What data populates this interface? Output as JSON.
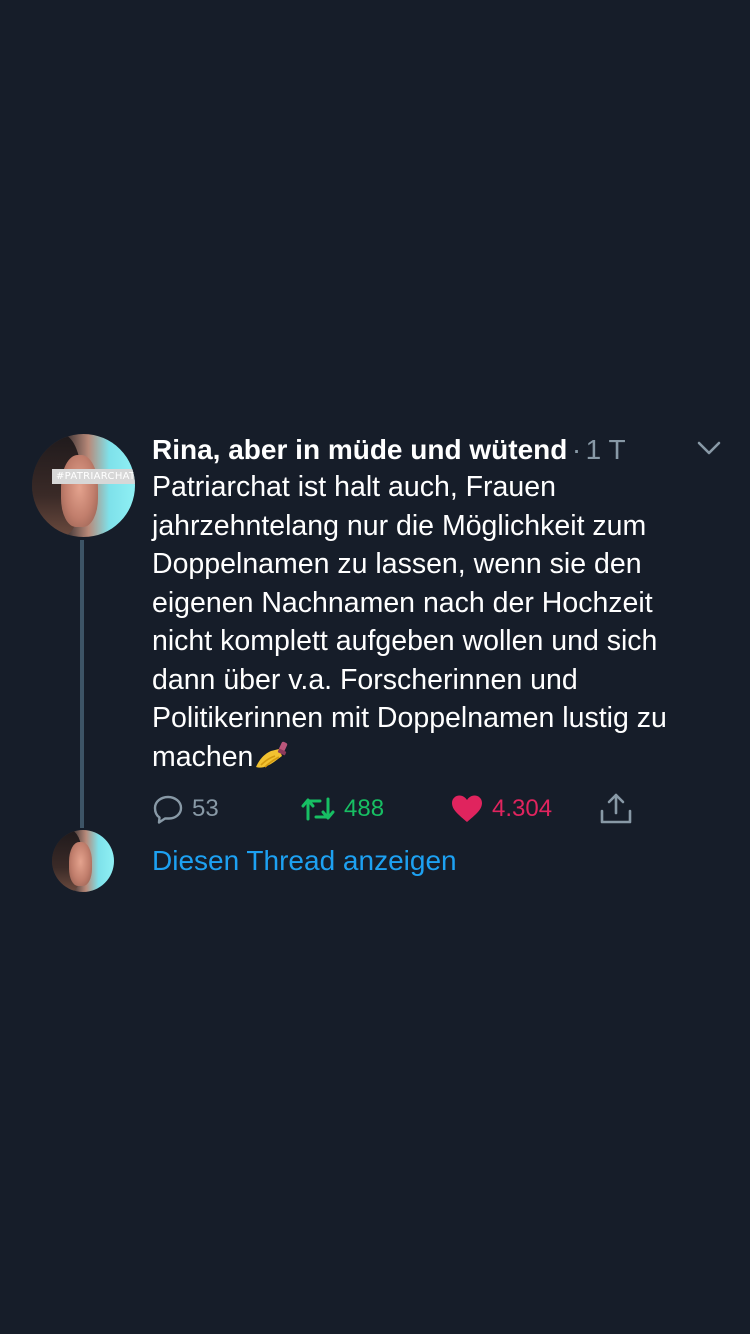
{
  "tweet": {
    "author": "Rina, aber in müde und wütend",
    "separator": "·",
    "time": "1 T",
    "avatar_tag": "#PATRIARCHAT",
    "text": "Patriarchat ist halt auch, Frauen\njahrzehntelang nur die Möglichkeit zum\nDoppelnamen zu lassen, wenn sie den\neigenen Nachnamen nach der Hochzeit\nnicht komplett aufgeben wollen und sich\ndann über v.a. Forscherinnen und\nPolitikerinnen mit Doppelnamen lustig zu\nmachen",
    "emoji": "nail-polish-icon",
    "reply_count": "53",
    "retweet_count": "488",
    "like_count": "4.304"
  },
  "thread": {
    "show_label": "Diesen Thread anzeigen"
  },
  "colors": {
    "background": "#161d29",
    "secondary_text": "#8899a6",
    "retweet": "#17bf63",
    "like": "#e0245e",
    "link": "#1da1f2"
  }
}
